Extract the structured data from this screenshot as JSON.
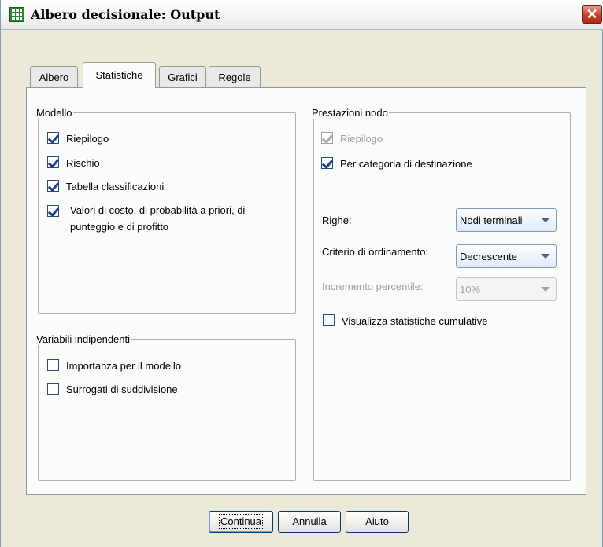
{
  "window": {
    "title": "Albero decisionale: Output",
    "close_symbol": "✕",
    "app_icon": "table-grid-icon"
  },
  "tabs": [
    {
      "label": "Albero",
      "active": false
    },
    {
      "label": "Statistiche",
      "active": true
    },
    {
      "label": "Grafici",
      "active": false
    },
    {
      "label": "Regole",
      "active": false
    }
  ],
  "modello": {
    "legend": "Modello",
    "items": [
      {
        "label": "Riepilogo",
        "checked": true
      },
      {
        "label": "Rischio",
        "checked": true
      },
      {
        "label": "Tabella classificazioni",
        "checked": true
      },
      {
        "label_line1": "Valori di costo, di probabilità a priori, di",
        "label_line2": "punteggio e di profitto",
        "checked": true
      }
    ]
  },
  "variabili": {
    "legend": "Variabili indipendenti",
    "items": [
      {
        "label": "Importanza per il modello",
        "checked": false
      },
      {
        "label": "Surrogati di suddivisione",
        "checked": false
      }
    ]
  },
  "prestazioni": {
    "legend": "Prestazioni nodo",
    "riepilogo": {
      "label": "Riepilogo",
      "checked": true,
      "disabled": true
    },
    "per_categoria": {
      "label": "Per categoria di destinazione",
      "checked": true
    },
    "righe": {
      "label": "Righe:",
      "value": "Nodi terminali"
    },
    "criterio": {
      "label": "Criterio di ordinamento:",
      "value": "Decrescente"
    },
    "incremento": {
      "label": "Incremento percentile:",
      "value": "10%",
      "disabled": true
    },
    "cumulative": {
      "label": "Visualizza statistiche cumulative",
      "checked": false
    }
  },
  "buttons": {
    "continua": "Continua",
    "annulla": "Annulla",
    "aiuto": "Aiuto"
  }
}
